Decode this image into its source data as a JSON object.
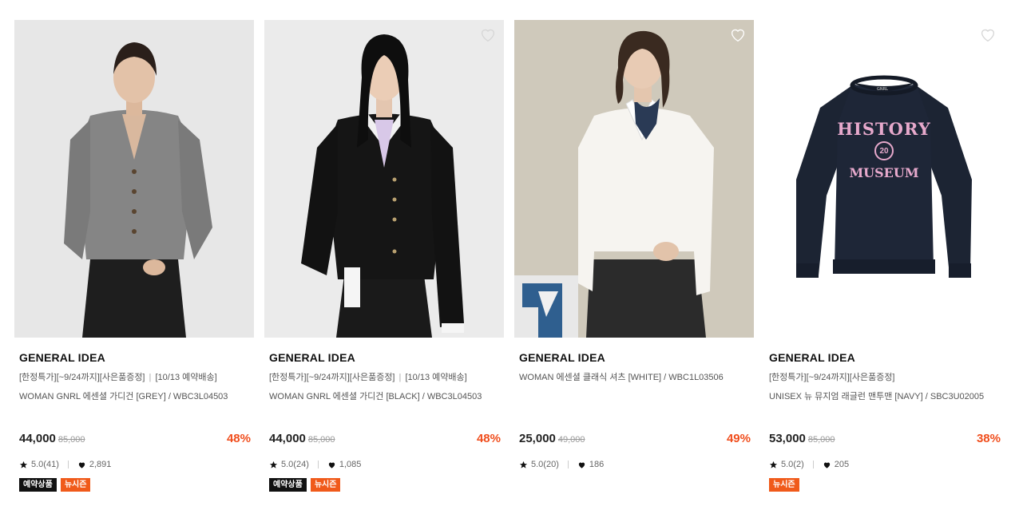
{
  "products": [
    {
      "brand": "GENERAL IDEA",
      "promo": "[한정특가][~9/24까지][사은품증정]",
      "promo_extra": "[10/13 예약배송]",
      "name": "WOMAN GNRL 에센셜 가디건 [GREY] / WBC3L04503",
      "price": "44,000",
      "original_price": "85,000",
      "discount": "48%",
      "rating": "5.0(41)",
      "likes": "2,891",
      "tags": [
        "예약상품",
        "뉴시즌"
      ],
      "image": "woman-grey-cardigan-photo",
      "wishlist_icon": "heart-outline-icon"
    },
    {
      "brand": "GENERAL IDEA",
      "promo": "[한정특가][~9/24까지][사은품증정]",
      "promo_extra": "[10/13 예약배송]",
      "name": "WOMAN GNRL 에센셜 가디건 [BLACK] / WBC3L04503",
      "price": "44,000",
      "original_price": "85,000",
      "discount": "48%",
      "rating": "5.0(24)",
      "likes": "1,085",
      "tags": [
        "예약상품",
        "뉴시즌"
      ],
      "image": "woman-black-cardigan-photo",
      "wishlist_icon": "heart-outline-icon"
    },
    {
      "brand": "GENERAL IDEA",
      "name": "WOMAN 에센셜 클래식 셔츠 [WHITE] / WBC1L03506",
      "price": "25,000",
      "original_price": "49,000",
      "discount": "49%",
      "rating": "5.0(20)",
      "likes": "186",
      "tags": [],
      "image": "woman-white-shirt-photo",
      "wishlist_icon": "heart-outline-icon"
    },
    {
      "brand": "GENERAL IDEA",
      "promo": "[한정특가][~9/24까지][사은품증정]",
      "name": "UNISEX 뉴 뮤지엄 래글런 맨투맨 [NAVY] / SBC3U02005",
      "price": "53,000",
      "original_price": "85,000",
      "discount": "38%",
      "rating": "5.0(2)",
      "likes": "205",
      "tags": [
        "뉴시즌"
      ],
      "image": "navy-sweatshirt-photo",
      "wishlist_icon": "heart-outline-icon",
      "print": {
        "top": "HISTORY",
        "badge": "20",
        "bottom": "MUSEUM",
        "label": "GNRL"
      }
    }
  ],
  "colors": {
    "discount": "#f04e1d",
    "tag_black": "#111111",
    "tag_orange": "#f05a1a"
  }
}
